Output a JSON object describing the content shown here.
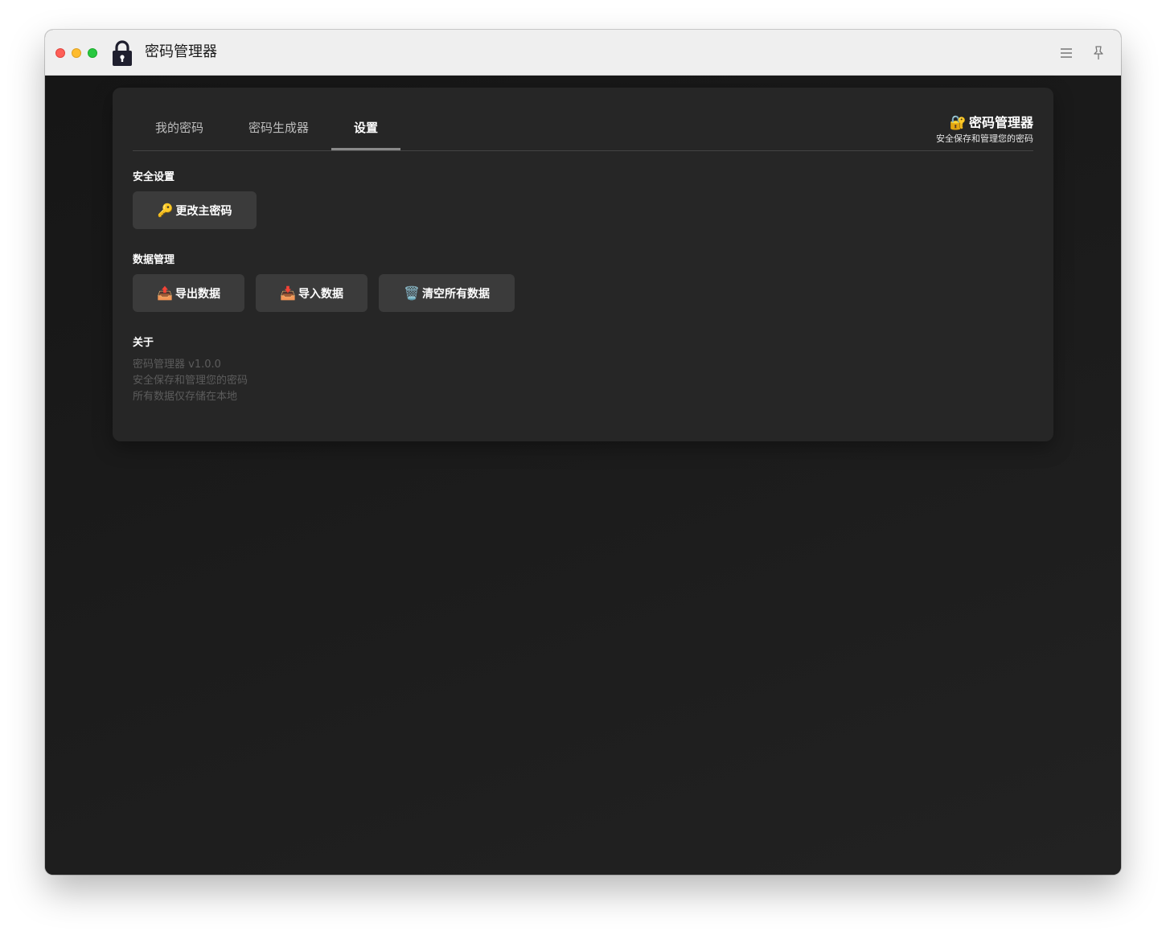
{
  "window": {
    "title": "密码管理器",
    "app_icon": "lock-icon",
    "toolbar_icons": [
      "menu-icon",
      "pin-icon"
    ]
  },
  "tabs": [
    {
      "label": "我的密码",
      "active": false
    },
    {
      "label": "密码生成器",
      "active": false
    },
    {
      "label": "设置",
      "active": true
    }
  ],
  "brand": {
    "emoji": "🔐",
    "title": "密码管理器",
    "subtitle": "安全保存和管理您的密码"
  },
  "security": {
    "title": "安全设置",
    "change_password": {
      "emoji": "🔑",
      "label": "更改主密码"
    }
  },
  "data_management": {
    "title": "数据管理",
    "export": {
      "emoji": "📤",
      "label": "导出数据"
    },
    "import": {
      "emoji": "📥",
      "label": "导入数据"
    },
    "clear": {
      "emoji": "🗑️",
      "label": "清空所有数据"
    }
  },
  "about": {
    "title": "关于",
    "lines": [
      "密码管理器 v1.0.0",
      "安全保存和管理您的密码",
      "所有数据仅存储在本地"
    ]
  },
  "colors": {
    "card_bg": "#262626",
    "button_bg": "#3b3b3b",
    "content_bg": "#1b1b1b",
    "titlebar_bg": "#efefef"
  }
}
